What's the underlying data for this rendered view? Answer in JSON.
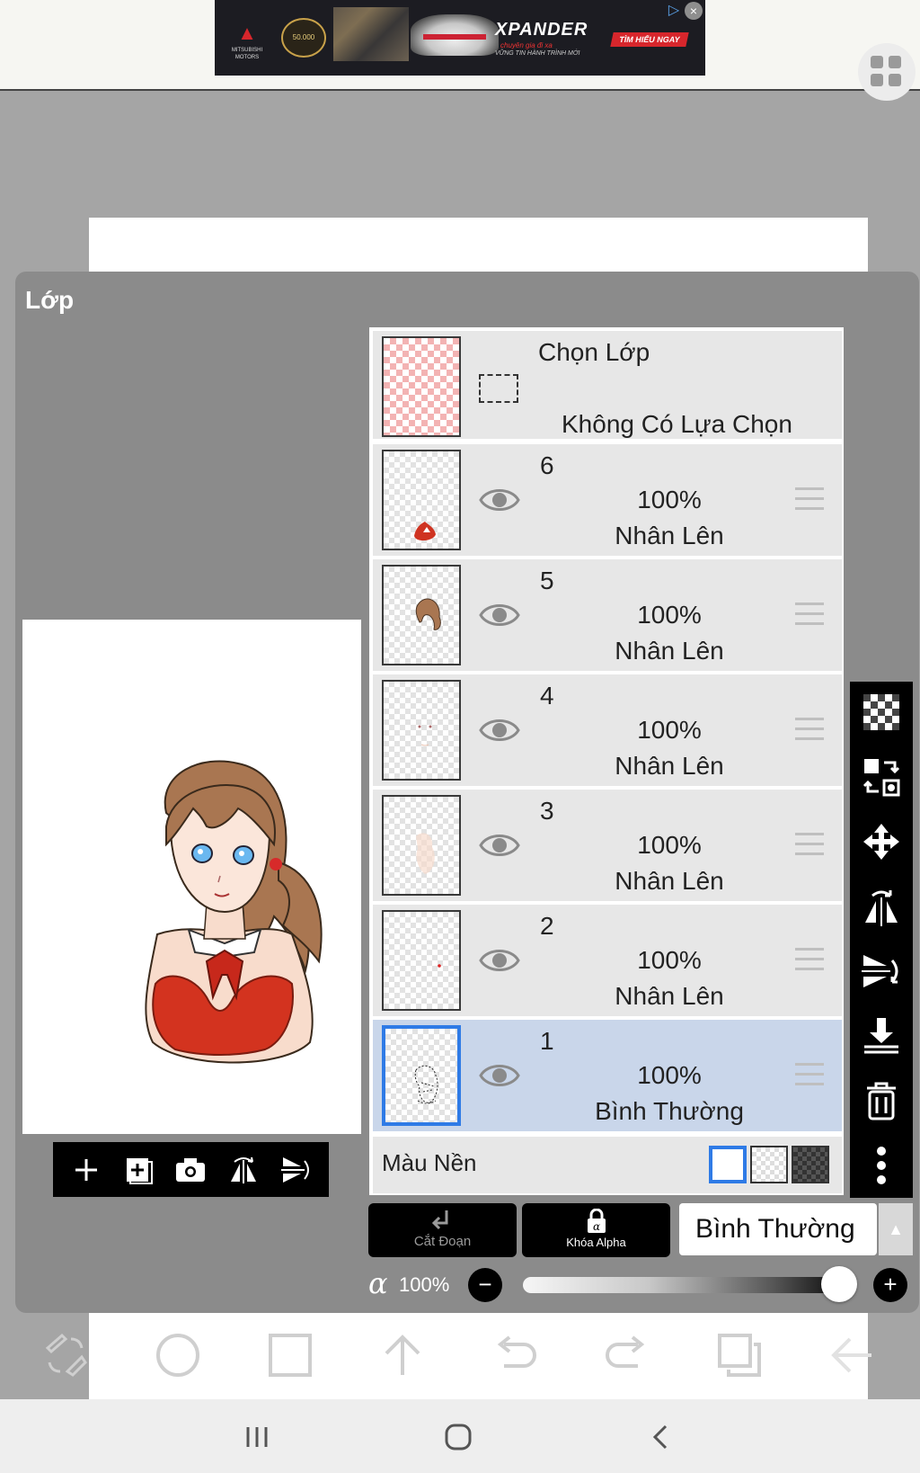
{
  "ad": {
    "brand": "XPANDER",
    "tagline": "chuyên gia đi xa",
    "subline": "VỮNG TIN HÀNH TRÌNH MỚI",
    "cta": "TÌM HIỂU NGAY",
    "badge": "50.000",
    "maker": "MITSUBISHI MOTORS"
  },
  "panel": {
    "title": "Lớp"
  },
  "selection": {
    "title": "Chọn Lớp",
    "subtitle": "Không Có Lựa Chọn"
  },
  "layers": [
    {
      "num": "6",
      "opacity": "100%",
      "mode": "Nhân Lên",
      "selected": false
    },
    {
      "num": "5",
      "opacity": "100%",
      "mode": "Nhân Lên",
      "selected": false
    },
    {
      "num": "4",
      "opacity": "100%",
      "mode": "Nhân Lên",
      "selected": false
    },
    {
      "num": "3",
      "opacity": "100%",
      "mode": "Nhân Lên",
      "selected": false
    },
    {
      "num": "2",
      "opacity": "100%",
      "mode": "Nhân Lên",
      "selected": false
    },
    {
      "num": "1",
      "opacity": "100%",
      "mode": "Bình Thường",
      "selected": true
    }
  ],
  "background": {
    "label": "Màu Nền"
  },
  "controls": {
    "clip_label": "Cắt Đoạn",
    "alpha_lock_label": "Khóa Alpha",
    "blend_mode": "Bình Thường",
    "alpha_symbol": "α",
    "opacity_value": "100%",
    "opacity_fraction": 1.0,
    "minus": "−",
    "plus": "+"
  },
  "colors": {
    "accent": "#2f7be6",
    "panel": "#8b8b8b",
    "selected_row": "#c9d6ea"
  }
}
